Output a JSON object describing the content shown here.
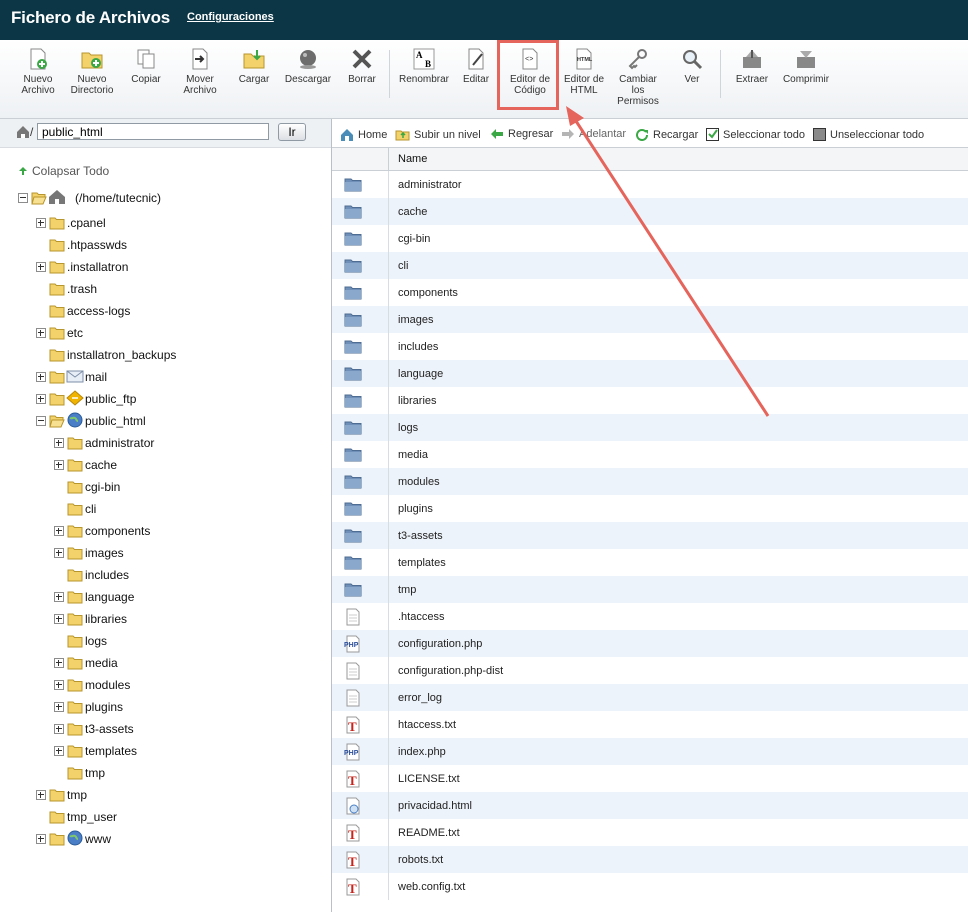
{
  "header": {
    "title": "Fichero de Archivos",
    "settings_link": "Configuraciones"
  },
  "toolbar": {
    "buttons": [
      {
        "label": "Nuevo\nArchivo",
        "icon": "new-file-icon"
      },
      {
        "label": "Nuevo\nDirectorio",
        "icon": "new-folder-icon"
      },
      {
        "label": "Copiar",
        "icon": "copy-icon"
      },
      {
        "label": "Mover\nArchivo",
        "icon": "move-icon"
      },
      {
        "label": "Cargar",
        "icon": "upload-icon"
      },
      {
        "label": "Descargar",
        "icon": "download-icon"
      },
      {
        "label": "Borrar",
        "icon": "delete-icon"
      },
      {
        "label": "Renombrar",
        "icon": "rename-icon"
      },
      {
        "label": "Editar",
        "icon": "edit-icon"
      },
      {
        "label": "Editor de\nCódigo",
        "icon": "code-editor-icon"
      },
      {
        "label": "Editor de\nHTML",
        "icon": "html-editor-icon"
      },
      {
        "label": "Cambiar\nlos\nPermisos",
        "icon": "permissions-icon"
      },
      {
        "label": "Ver",
        "icon": "view-icon"
      },
      {
        "label": "Extraer",
        "icon": "extract-icon"
      },
      {
        "label": "Comprimir",
        "icon": "compress-icon"
      }
    ]
  },
  "pathbar": {
    "prefix": "/",
    "value": "public_html",
    "go_label": "Ir"
  },
  "tree": {
    "collapse_all": "Colapsar Todo",
    "root_label": "(/home/tutecnic)",
    "top_level": [
      {
        "name": ".cpanel",
        "expandable": true
      },
      {
        "name": ".htpasswds",
        "expandable": false
      },
      {
        "name": ".installatron",
        "expandable": true
      },
      {
        "name": ".trash",
        "expandable": false
      },
      {
        "name": "access-logs",
        "expandable": false
      },
      {
        "name": "etc",
        "expandable": true
      },
      {
        "name": "installatron_backups",
        "expandable": false
      },
      {
        "name": "mail",
        "expandable": true
      },
      {
        "name": "public_ftp",
        "expandable": true
      },
      {
        "name": "public_html",
        "expandable": true
      }
    ],
    "public_html_children": [
      {
        "name": "administrator",
        "expandable": true
      },
      {
        "name": "cache",
        "expandable": true
      },
      {
        "name": "cgi-bin",
        "expandable": false
      },
      {
        "name": "cli",
        "expandable": false
      },
      {
        "name": "components",
        "expandable": true
      },
      {
        "name": "images",
        "expandable": true
      },
      {
        "name": "includes",
        "expandable": false
      },
      {
        "name": "language",
        "expandable": true
      },
      {
        "name": "libraries",
        "expandable": true
      },
      {
        "name": "logs",
        "expandable": false
      },
      {
        "name": "media",
        "expandable": true
      },
      {
        "name": "modules",
        "expandable": true
      },
      {
        "name": "plugins",
        "expandable": true
      },
      {
        "name": "t3-assets",
        "expandable": true
      },
      {
        "name": "templates",
        "expandable": true
      },
      {
        "name": "tmp",
        "expandable": false
      }
    ],
    "bottom_level": [
      {
        "name": "tmp",
        "expandable": true
      },
      {
        "name": "tmp_user",
        "expandable": false
      },
      {
        "name": "www",
        "expandable": true
      }
    ]
  },
  "navbar": {
    "home": "Home",
    "up": "Subir un nivel",
    "back": "Regresar",
    "forward": "Adelantar",
    "reload": "Recargar",
    "select_all": "Seleccionar todo",
    "unselect_all": "Unseleccionar todo"
  },
  "grid": {
    "column_name": "Name",
    "rows": [
      {
        "name": "administrator",
        "type": "folder"
      },
      {
        "name": "cache",
        "type": "folder"
      },
      {
        "name": "cgi-bin",
        "type": "folder"
      },
      {
        "name": "cli",
        "type": "folder"
      },
      {
        "name": "components",
        "type": "folder"
      },
      {
        "name": "images",
        "type": "folder"
      },
      {
        "name": "includes",
        "type": "folder"
      },
      {
        "name": "language",
        "type": "folder"
      },
      {
        "name": "libraries",
        "type": "folder"
      },
      {
        "name": "logs",
        "type": "folder"
      },
      {
        "name": "media",
        "type": "folder"
      },
      {
        "name": "modules",
        "type": "folder"
      },
      {
        "name": "plugins",
        "type": "folder"
      },
      {
        "name": "t3-assets",
        "type": "folder"
      },
      {
        "name": "templates",
        "type": "folder"
      },
      {
        "name": "tmp",
        "type": "folder"
      },
      {
        "name": ".htaccess",
        "type": "generic"
      },
      {
        "name": "configuration.php",
        "type": "php"
      },
      {
        "name": "configuration.php-dist",
        "type": "generic"
      },
      {
        "name": "error_log",
        "type": "generic"
      },
      {
        "name": "htaccess.txt",
        "type": "text"
      },
      {
        "name": "index.php",
        "type": "php"
      },
      {
        "name": "LICENSE.txt",
        "type": "text"
      },
      {
        "name": "privacidad.html",
        "type": "html"
      },
      {
        "name": "README.txt",
        "type": "text"
      },
      {
        "name": "robots.txt",
        "type": "text"
      },
      {
        "name": "web.config.txt",
        "type": "text"
      }
    ]
  },
  "colors": {
    "header_bg": "#0c3646",
    "highlight": "#e5645b",
    "row_alt": "#edf3fa",
    "folder_blue": "#6f8fb8",
    "folder_yellow": "#f3d26b"
  }
}
